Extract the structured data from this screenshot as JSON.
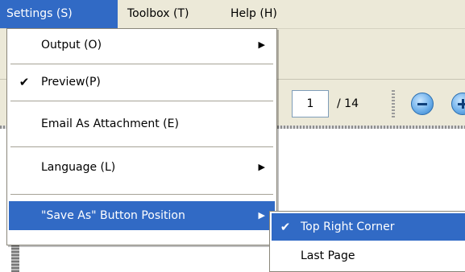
{
  "menubar": {
    "items": [
      {
        "label": "Settings (S)",
        "active": true
      },
      {
        "label": "Toolbox (T)",
        "active": false
      },
      {
        "label": "Help (H)",
        "active": false
      }
    ]
  },
  "settings_menu": {
    "items": [
      {
        "label": "Output (O)",
        "checked": false,
        "has_submenu": true
      },
      {
        "label": "Preview(P)",
        "checked": true,
        "has_submenu": false
      },
      {
        "label": "Email As Attachment (E)",
        "checked": false,
        "has_submenu": false
      },
      {
        "label": "Language (L)",
        "checked": false,
        "has_submenu": true
      },
      {
        "label": "\"Save As\" Button Position",
        "checked": false,
        "has_submenu": true,
        "highlighted": true
      }
    ],
    "check_glyph": "✔",
    "arrow_glyph": "▶"
  },
  "save_as_submenu": {
    "items": [
      {
        "label": "Top Right Corner",
        "checked": true,
        "highlighted": true
      },
      {
        "label": "Last Page",
        "checked": false,
        "highlighted": false
      }
    ]
  },
  "toolbar": {
    "page_current": "1",
    "page_total": "/ 14",
    "zoom_out_icon": "zoom-out-icon",
    "zoom_in_icon": "zoom-in-icon"
  },
  "colors": {
    "highlight": "#316ac5",
    "menubar_bg": "#ece9d8"
  }
}
